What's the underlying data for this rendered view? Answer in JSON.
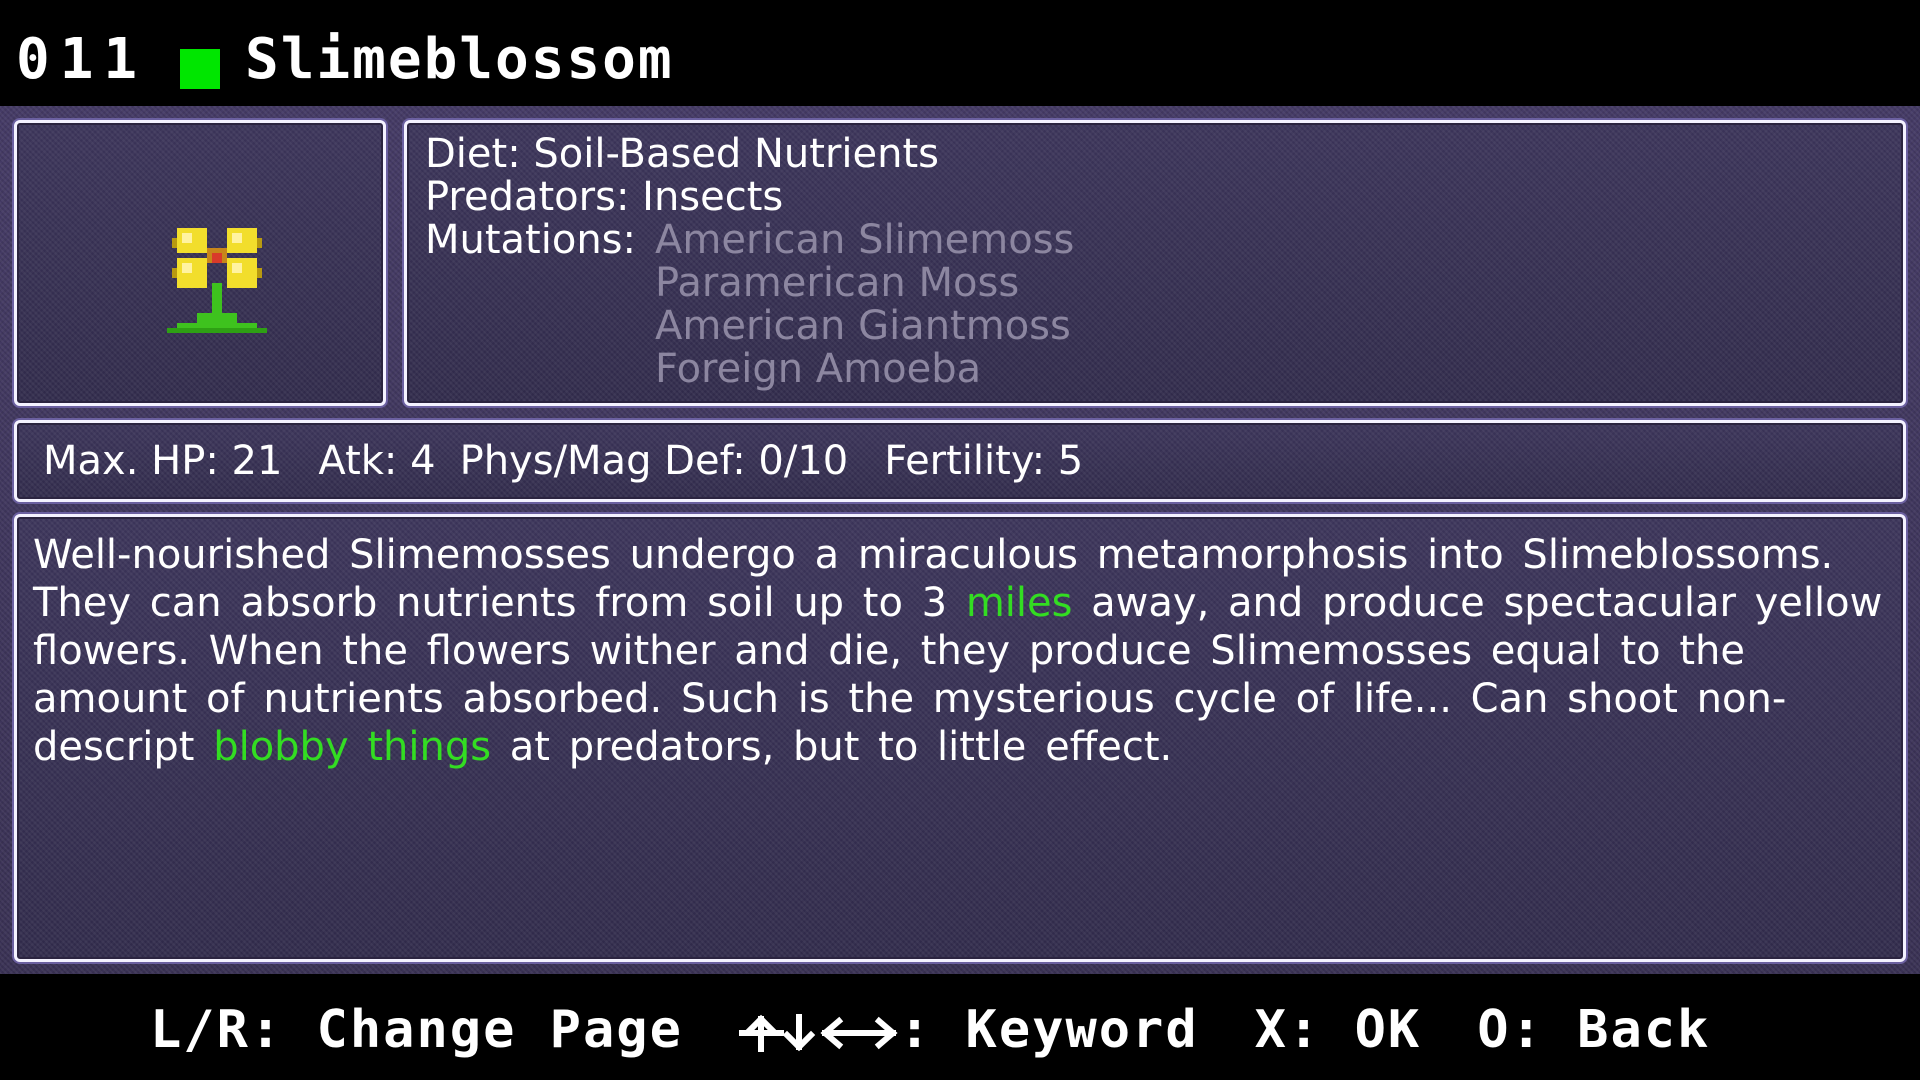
{
  "header": {
    "entry_number": "011",
    "status_color": "#00e600",
    "species_name": "Slimeblossom"
  },
  "portrait": {
    "icon": "yellow-flower-sprite-icon"
  },
  "info": {
    "diet_label": "Diet:",
    "diet_value": "Soil-Based Nutrients",
    "predators_label": "Predators:",
    "predators_value": "Insects",
    "mutations_label": "Mutations:",
    "mutations": [
      "American Slimemoss",
      "Paramerican Moss",
      "American Giantmoss",
      "Foreign Amoeba"
    ]
  },
  "stats": {
    "hp": "Max. HP: 21",
    "atk": "Atk: 4",
    "def": "Phys/Mag Def: 0/10",
    "fertility": "Fertility: 5"
  },
  "description": {
    "part1": "Well-nourished Slimemosses undergo a miraculous metamorphosis into Slimeblossoms. They can absorb nutrients from soil up to 3 ",
    "keyword1": "miles",
    "part2": " away, and produce spectacular yellow flowers. When the flowers wither and die, they produce Slimemosses equal to the amount of nutrients absorbed. Such is the mysterious cycle of life... Can shoot non-descript ",
    "keyword2": "blobby things",
    "part3": " at predators, but to little effect."
  },
  "footer": {
    "change_page": "L/R: Change Page",
    "keyword_suffix": ": Keyword",
    "keyword_icon": "four-way-arrows-icon",
    "ok": "X: OK",
    "back": "O: Back"
  },
  "colors": {
    "keyword": "#33dd22",
    "mutation_dimmed": "#8c86a0",
    "panel_border": "#f4f2ff",
    "background": "#3d3559"
  }
}
